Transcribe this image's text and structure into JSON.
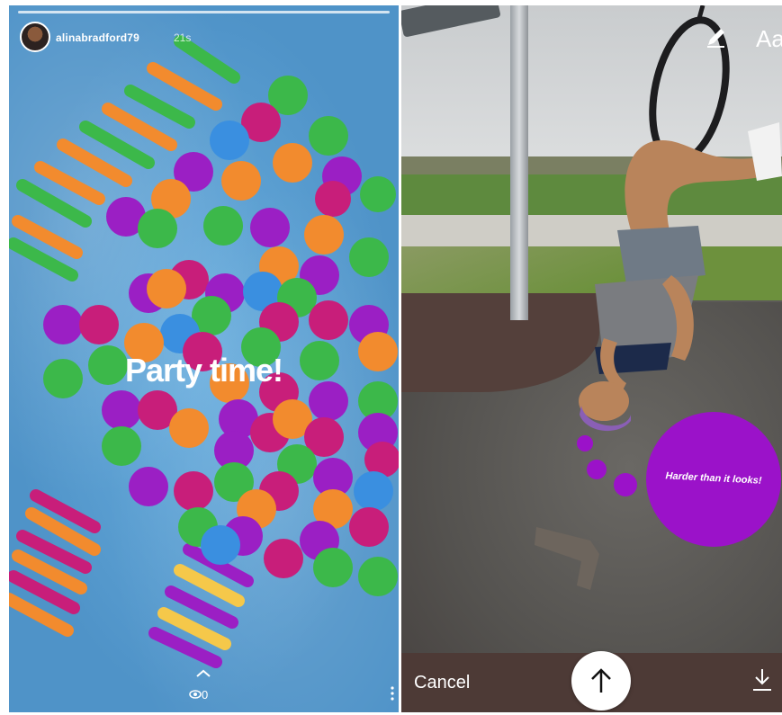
{
  "left_story": {
    "username": "alinabradford79",
    "time": "21s",
    "caption": "Party time!",
    "seen_count": "0",
    "background_color": "#5a9ccf",
    "sticker_colors": [
      "#3cb84a",
      "#f28b2e",
      "#c81e7a",
      "#9b1fc4",
      "#3a8fe0"
    ]
  },
  "right_editor": {
    "cancel_label": "Cancel",
    "text_tool_label": "Aa",
    "thought_bubble_text": "Harder than it looks!",
    "bubble_color": "#9b12c9",
    "icons": [
      "pencil-icon",
      "send-arrow-icon",
      "download-icon"
    ]
  }
}
